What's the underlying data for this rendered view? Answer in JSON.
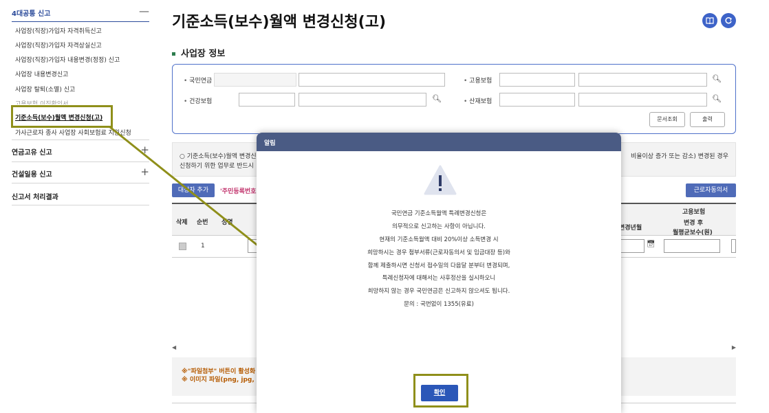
{
  "sidebar": {
    "sections": [
      {
        "label": "4대공통 신고",
        "toggle": "—"
      },
      {
        "label": "연금고유 신고",
        "toggle": "+"
      },
      {
        "label": "건설일용 신고",
        "toggle": "+"
      },
      {
        "label": "신고서 처리결과",
        "toggle": ""
      }
    ],
    "items": [
      "사업장(직장)가입자 자격취득신고",
      "사업장(직장)가입자 자격상실신고",
      "사업장(직장)가입자 내용변경(정정) 신고",
      "사업장 내용변경신고",
      "사업장 탈퇴(소멸) 신고",
      "고용보험 이직확인서",
      "기준소득(보수)월액 변경신청(고)",
      "가사근로자 종사 사업장 사회보험료 지원신청"
    ]
  },
  "header": {
    "title": "기준소득(보수)월액 변경신청(고)",
    "icons": [
      "book-icon",
      "refresh-icon"
    ]
  },
  "workplace": {
    "section_title": "사업장 정보",
    "labels": {
      "pension": "국민연금",
      "health": "건강보험",
      "employment": "고용보험",
      "industrial": "산재보험"
    },
    "buttons": {
      "doc_query": "문서조회",
      "print": "출력"
    }
  },
  "notice": {
    "line1": "○ 기준소득(보수)월액 변경신",
    "line1_right": "비율이상 증가 또는 감소) 변경된 경우",
    "line2": "신청하기 위한 업무로 반드시"
  },
  "toolbar": {
    "target_button": "대상자 추가",
    "pink_note": "'주민등록번호",
    "worker_consent_button": "근로자동의서"
  },
  "grid": {
    "headers": {
      "delete": "삭제",
      "seq": "순번",
      "name": "성명",
      "change_ym": "변경년월",
      "employment_group": "고용보험",
      "after_change": "변경 후",
      "avg_monthly": "월평균보수(원)"
    },
    "rows": [
      {
        "seq": "1"
      }
    ]
  },
  "warning": {
    "line1": "※\"파일첨부\" 버튼이 활성화",
    "line2": "※ 이미지 파일(png, jpg, gif"
  },
  "modal": {
    "title": "알림",
    "message_lines": [
      "국민연금 기준소득월액 특례변경신청은",
      "의무적으로 신고하는 사항이 아닙니다.",
      "현재의 기준소득월액 대비 20%이상 소득변경 시",
      "희망하시는 경우 첨부서류(근로자동의서 및 임금대장 등)와",
      "함께 제출하시면 신청서 접수일의 다음달 분부터 변경되며,",
      "특례신청자에 대해서는 사후정산을 실시하오니",
      "희망하지 않는 경우 국민연금은 신고하지 않으셔도 됩니다.",
      "문의 : 국번없이 1355(유료)"
    ],
    "ok_button": "확인"
  },
  "colors": {
    "modal_header": "#4a5b84",
    "primary": "#2b57b8",
    "highlight": "#8f8f1a"
  }
}
